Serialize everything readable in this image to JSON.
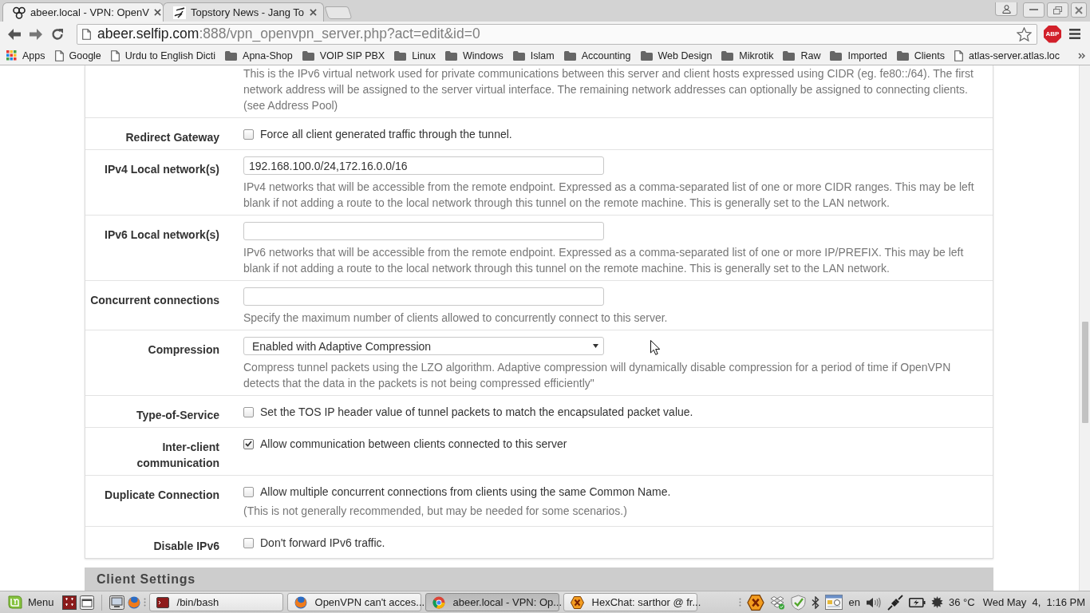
{
  "browser": {
    "tabs": [
      {
        "title": "abeer.local - VPN: OpenV",
        "selected": true,
        "kind": "circles"
      },
      {
        "title": "Topstory News - Jang To",
        "selected": false,
        "kind": "calligraphy"
      }
    ],
    "address": {
      "host": "abeer.selfip.com",
      "path": ":888/vpn_openvpn_server.php?act=edit&id=0"
    },
    "extension_badge": "ABP",
    "bookmarks": [
      {
        "kind": "apps",
        "label": "Apps"
      },
      {
        "kind": "page",
        "label": "Google"
      },
      {
        "kind": "page",
        "label": "Urdu to English Dicti"
      },
      {
        "kind": "folder",
        "label": "Apna-Shop"
      },
      {
        "kind": "folder",
        "label": "VOIP SIP PBX"
      },
      {
        "kind": "folder",
        "label": "Linux"
      },
      {
        "kind": "folder",
        "label": "Windows"
      },
      {
        "kind": "folder",
        "label": "Islam"
      },
      {
        "kind": "folder",
        "label": "Accounting"
      },
      {
        "kind": "folder",
        "label": "Web Design"
      },
      {
        "kind": "folder",
        "label": "Mikrotik"
      },
      {
        "kind": "folder",
        "label": "Raw"
      },
      {
        "kind": "folder",
        "label": "Imported"
      },
      {
        "kind": "folder",
        "label": "Clients"
      },
      {
        "kind": "page",
        "label": "atlas-server.atlas.loc"
      }
    ]
  },
  "form": {
    "intro": "This is the IPv6 virtual network used for private communications between this server and client hosts expressed using CIDR (eg. fe80::/64). The first network address will be assigned to the server virtual interface. The remaining network addresses can optionally be assigned to connecting clients. (see Address Pool)",
    "rows": [
      {
        "kind": "checkbox",
        "label": "Redirect Gateway",
        "option": "Force all client generated traffic through the tunnel.",
        "checked": false
      },
      {
        "kind": "text",
        "label": "IPv4 Local network(s)",
        "value": "192.168.100.0/24,172.16.0.0/16",
        "help": "IPv4 networks that will be accessible from the remote endpoint. Expressed as a comma-separated list of one or more CIDR ranges. This may be left blank if not adding a route to the local network through this tunnel on the remote machine. This is generally set to the LAN network."
      },
      {
        "kind": "text",
        "label": "IPv6 Local network(s)",
        "help": "IPv6 networks that will be accessible from the remote endpoint. Expressed as a comma-separated list of one or more IP/PREFIX. This may be left blank if not adding a route to the local network through this tunnel on the remote machine. This is generally set to the LAN network."
      },
      {
        "kind": "text",
        "label": "Concurrent connections",
        "help": "Specify the maximum number of clients allowed to concurrently connect to this server."
      },
      {
        "kind": "select",
        "label": "Compression",
        "value": "Enabled with Adaptive Compression",
        "help": "Compress tunnel packets using the LZO algorithm. Adaptive compression will dynamically disable compression for a period of time if OpenVPN detects that the data in the packets is not being compressed efficiently\""
      },
      {
        "kind": "checkbox",
        "label": "Type-of-Service",
        "option": "Set the TOS IP header value of tunnel packets to match the encapsulated packet value.",
        "checked": false
      },
      {
        "kind": "checkbox",
        "label": "Inter-client communication",
        "option": "Allow communication between clients connected to this server",
        "checked": true
      },
      {
        "kind": "checkbox",
        "label": "Duplicate Connection",
        "option": "Allow multiple concurrent connections from clients using the same Common Name.",
        "checked": false,
        "help": "(This is not generally recommended, but may be needed for some scenarios.)"
      },
      {
        "kind": "checkbox",
        "label": "Disable IPv6",
        "option": "Don't forward IPv6 traffic.",
        "checked": false
      }
    ]
  },
  "section_title": "Client Settings",
  "taskbar": {
    "menu": "Menu",
    "windows": [
      {
        "kind": "terminal",
        "title": "/bin/bash",
        "selected": false
      },
      {
        "kind": "fox",
        "title": "OpenVPN can't acces...",
        "selected": false
      },
      {
        "kind": "chrome",
        "title": "abeer.local - VPN: Op...",
        "selected": true
      },
      {
        "kind": "chat",
        "title": "HexChat: sarthor @ fr...",
        "selected": false
      }
    ],
    "language": "en",
    "temperature": "36 °C",
    "clock": "Wed May  4,  1:16 PM"
  }
}
